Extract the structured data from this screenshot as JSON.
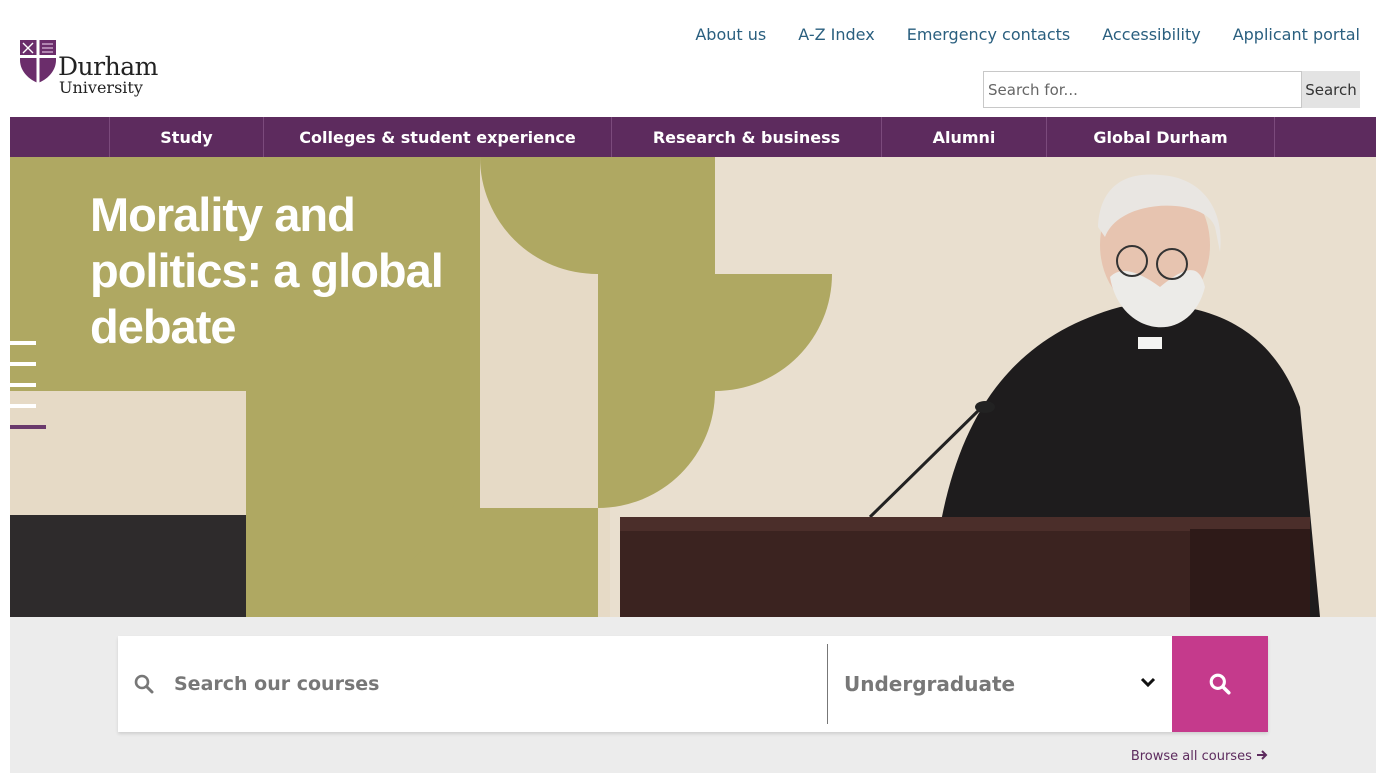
{
  "header": {
    "logo": {
      "name": "Durham",
      "subname": "University"
    },
    "utility_nav": [
      {
        "label": "About us"
      },
      {
        "label": "A-Z Index"
      },
      {
        "label": "Emergency contacts"
      },
      {
        "label": "Accessibility"
      },
      {
        "label": "Applicant portal"
      }
    ],
    "search": {
      "placeholder": "Search for...",
      "button_label": "Search"
    }
  },
  "main_nav": {
    "items": [
      {
        "label": "Study"
      },
      {
        "label": "Colleges & student experience"
      },
      {
        "label": "Research & business"
      },
      {
        "label": "Alumni"
      },
      {
        "label": "Global Durham"
      }
    ]
  },
  "hero": {
    "title": "Morality and politics: a global debate"
  },
  "course_search": {
    "placeholder": "Search our courses",
    "level_selected": "Undergraduate",
    "browse_label": "Browse all courses"
  },
  "colors": {
    "brand_purple": "#5d2b5e",
    "accent_pink": "#c53a8c",
    "hero_olive": "#afa862",
    "hero_cream": "#e8dcc8",
    "link_blue": "#2a5f7f"
  },
  "icons": {
    "search": "search-icon",
    "chevron": "chevron-down-icon",
    "arrow": "arrow-right-icon"
  }
}
